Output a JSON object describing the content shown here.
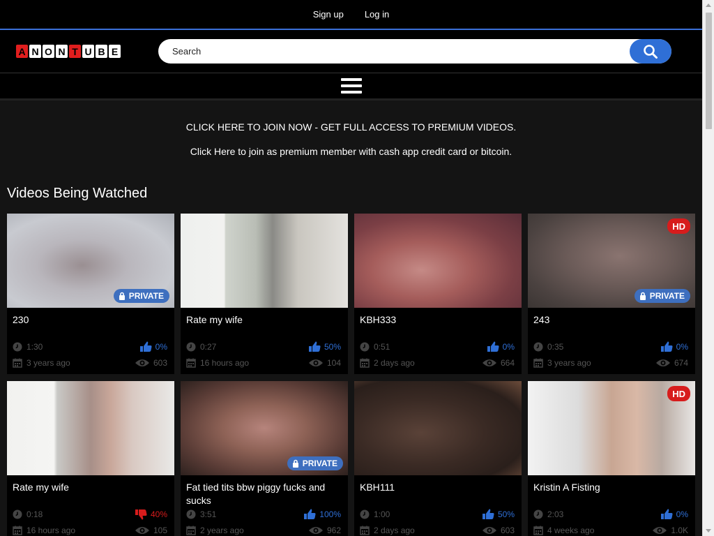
{
  "topbar": {
    "signup": "Sign up",
    "login": "Log in"
  },
  "logo": {
    "letters": [
      "A",
      "N",
      "O",
      "N",
      "T",
      "U",
      "B",
      "E"
    ],
    "red_indices": [
      0,
      4
    ],
    "alt": "ANONTUBE"
  },
  "search": {
    "placeholder": "Search"
  },
  "promo": {
    "line1": "CLICK HERE TO JOIN NOW - GET FULL ACCESS TO PREMIUM VIDEOS.",
    "line2": "Click Here to join as premium member with cash app credit card or bitcoin."
  },
  "section_title": "Videos Being Watched",
  "badges": {
    "private": "PRIVATE",
    "hd": "HD"
  },
  "colors": {
    "accent": "#2f6fd6",
    "hd": "#d71c1c",
    "private": "#3e6fbf",
    "dislike": "#d71c1c"
  },
  "videos": [
    {
      "title": "230",
      "duration": "1:30",
      "rating": "0%",
      "rating_type": "like",
      "age": "3 years ago",
      "views": "603",
      "private": true,
      "hd": false,
      "thumb": "blur-bath"
    },
    {
      "title": "Rate my wife",
      "duration": "0:27",
      "rating": "50%",
      "rating_type": "like",
      "age": "16 hours ago",
      "views": "104",
      "private": false,
      "hd": false,
      "thumb": "mirror-selfie"
    },
    {
      "title": "KBH333",
      "duration": "0:51",
      "rating": "0%",
      "rating_type": "like",
      "age": "2 days ago",
      "views": "664",
      "private": false,
      "hd": false,
      "thumb": "closeup-pink"
    },
    {
      "title": "243",
      "duration": "0:35",
      "rating": "0%",
      "rating_type": "like",
      "age": "3 years ago",
      "views": "674",
      "private": true,
      "hd": true,
      "thumb": "blur-room"
    },
    {
      "title": "Rate my wife",
      "duration": "0:18",
      "rating": "40%",
      "rating_type": "dislike",
      "age": "16 hours ago",
      "views": "105",
      "private": false,
      "hd": false,
      "thumb": "mirror-back"
    },
    {
      "title": "Fat tied tits bbw piggy fucks and sucks",
      "duration": "3:51",
      "rating": "100%",
      "rating_type": "like",
      "age": "2 years ago",
      "views": "962",
      "private": true,
      "hd": false,
      "thumb": "blur-dark"
    },
    {
      "title": "KBH111",
      "duration": "1:00",
      "rating": "50%",
      "rating_type": "like",
      "age": "2 days ago",
      "views": "603",
      "private": false,
      "hd": false,
      "thumb": "closeup-dark"
    },
    {
      "title": "Kristin A Fisting",
      "duration": "2:03",
      "rating": "0%",
      "rating_type": "like",
      "age": "4 weeks ago",
      "views": "1.0K",
      "private": false,
      "hd": true,
      "thumb": "blur-bed"
    }
  ]
}
